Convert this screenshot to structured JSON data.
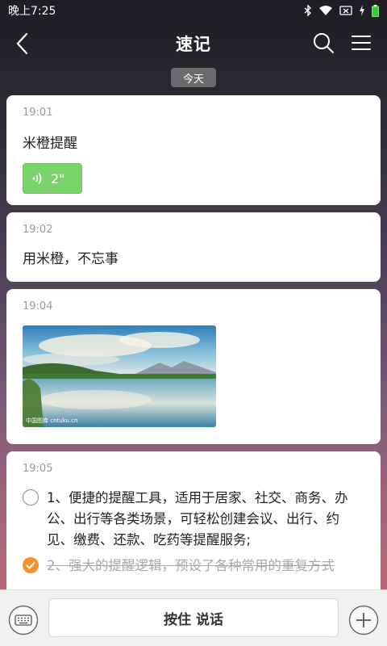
{
  "status": {
    "time": "晚上7:25"
  },
  "header": {
    "title": "速记"
  },
  "date_chip": "今天",
  "notes": [
    {
      "time": "19:01",
      "text": "米橙提醒",
      "voice_duration": "2\""
    },
    {
      "time": "19:02",
      "text": "用米橙，不忘事"
    },
    {
      "time": "19:04",
      "image_watermark": "中国图库 cntuku.cn"
    },
    {
      "time": "19:05",
      "todos": [
        {
          "text": "1、便捷的提醒工具，适用于居家、社交、商务、办公、出行等各类场景，可轻松创建会议、出行、约见、缴费、还款、吃药等提醒服务;",
          "done": false
        },
        {
          "text": "2、强大的提醒逻辑，预设了各种常用的重复方式",
          "done": true
        }
      ]
    }
  ],
  "bottom": {
    "hold_label": "按住 说话"
  },
  "colors": {
    "voice": "#7bd46a",
    "check_done": "#f5902a"
  }
}
